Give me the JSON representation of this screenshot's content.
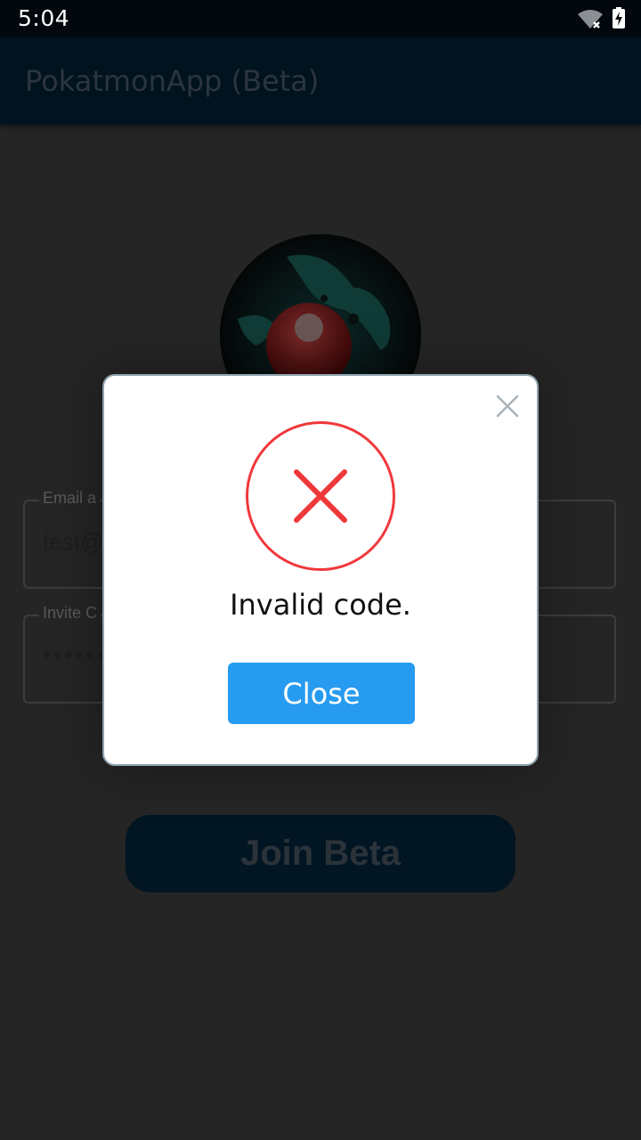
{
  "status_bar": {
    "time": "5:04",
    "icons": [
      "wifi-off-icon",
      "battery-charging-icon"
    ]
  },
  "app_bar": {
    "title": "PokatmonApp (Beta)",
    "color": "#021320"
  },
  "form": {
    "email": {
      "label": "Email a",
      "value": "test@"
    },
    "invite_code": {
      "label": "Invite C",
      "value": "•••••••"
    },
    "join_button_label": "Join Beta"
  },
  "dialog": {
    "icon": "error-x-icon",
    "icon_color": "#f0383b",
    "message": "Invalid code.",
    "close_button_label": "Close",
    "close_button_color": "#279bf0",
    "dismiss_icon": "close-icon"
  }
}
